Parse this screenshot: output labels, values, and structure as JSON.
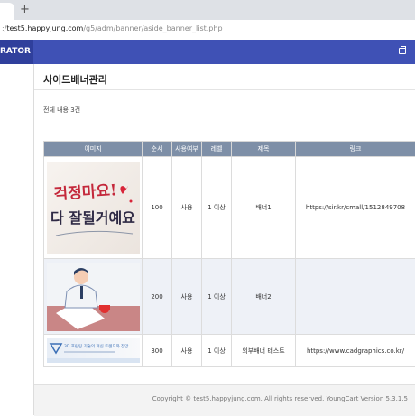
{
  "browser": {
    "new_tab_symbol": "+",
    "url_prefix": ":/",
    "url_host": "test5.happyjung.com",
    "url_path": "/g5/adm/banner/aside_banner_list.php"
  },
  "header": {
    "brand": "RATOR",
    "icon": "calendar-icon"
  },
  "page": {
    "title": "사이드배너관리",
    "count_text": "전체 내용 3건"
  },
  "table": {
    "columns": [
      "이미지",
      "순서",
      "사용여부",
      "레벨",
      "제목",
      "링크"
    ],
    "rows": [
      {
        "image": "calligraphy-banner",
        "order": "100",
        "use": "사용",
        "level": "1 이상",
        "title": "배너1",
        "link": "https://sir.kr/cmall/1512849708"
      },
      {
        "image": "person-at-desk-banner",
        "order": "200",
        "use": "사용",
        "level": "1 이상",
        "title": "배너2",
        "link": ""
      },
      {
        "image": "cad-graphics-banner",
        "order": "300",
        "use": "사용",
        "level": "1 이상",
        "title": "외부배너 테스트",
        "link": "https://www.cadgraphics.co.kr/"
      }
    ]
  },
  "banner_texts": {
    "calligraphy_line1": "걱정마요!",
    "calligraphy_line2": "다 잘될거예요",
    "cad_text": "3D 프린팅 기술의 혁신 트렌드와 전망"
  },
  "footer": {
    "copyright": "Copyright © test5.happyjung.com. All rights reserved. YoungCart Version 5.3.1.5"
  },
  "colors": {
    "header_bg": "#3f51b5",
    "brand_bg": "#2f3f9c",
    "table_header": "#7e8fa7",
    "alt_row": "#eef1f7"
  }
}
